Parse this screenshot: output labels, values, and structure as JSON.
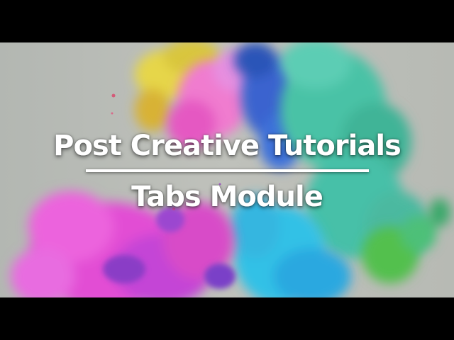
{
  "video": {
    "title": "Post Creative Tutorials",
    "subtitle": "Tabs Module"
  },
  "colors": {
    "background": "#b9bcb6",
    "letterbox": "#000000",
    "text": "#ffffff",
    "ink_pink": "#e03bd0",
    "ink_magenta": "#c83fe0",
    "ink_yellow": "#e3d23a",
    "ink_teal": "#3fbf9b",
    "ink_blue": "#2f6fd6",
    "ink_cyan": "#2fc4e6",
    "ink_green": "#4cbf4a"
  }
}
